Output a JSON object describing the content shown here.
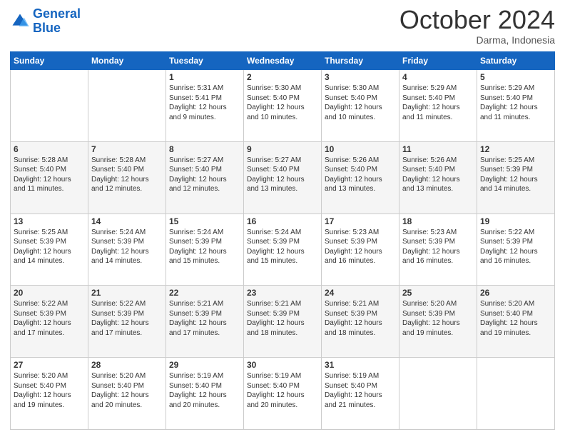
{
  "header": {
    "logo_line1": "General",
    "logo_line2": "Blue",
    "month": "October 2024",
    "location": "Darma, Indonesia"
  },
  "days_of_week": [
    "Sunday",
    "Monday",
    "Tuesday",
    "Wednesday",
    "Thursday",
    "Friday",
    "Saturday"
  ],
  "weeks": [
    [
      {
        "day": "",
        "info": ""
      },
      {
        "day": "",
        "info": ""
      },
      {
        "day": "1",
        "info": "Sunrise: 5:31 AM\nSunset: 5:41 PM\nDaylight: 12 hours and 9 minutes."
      },
      {
        "day": "2",
        "info": "Sunrise: 5:30 AM\nSunset: 5:40 PM\nDaylight: 12 hours and 10 minutes."
      },
      {
        "day": "3",
        "info": "Sunrise: 5:30 AM\nSunset: 5:40 PM\nDaylight: 12 hours and 10 minutes."
      },
      {
        "day": "4",
        "info": "Sunrise: 5:29 AM\nSunset: 5:40 PM\nDaylight: 12 hours and 11 minutes."
      },
      {
        "day": "5",
        "info": "Sunrise: 5:29 AM\nSunset: 5:40 PM\nDaylight: 12 hours and 11 minutes."
      }
    ],
    [
      {
        "day": "6",
        "info": "Sunrise: 5:28 AM\nSunset: 5:40 PM\nDaylight: 12 hours and 11 minutes."
      },
      {
        "day": "7",
        "info": "Sunrise: 5:28 AM\nSunset: 5:40 PM\nDaylight: 12 hours and 12 minutes."
      },
      {
        "day": "8",
        "info": "Sunrise: 5:27 AM\nSunset: 5:40 PM\nDaylight: 12 hours and 12 minutes."
      },
      {
        "day": "9",
        "info": "Sunrise: 5:27 AM\nSunset: 5:40 PM\nDaylight: 12 hours and 13 minutes."
      },
      {
        "day": "10",
        "info": "Sunrise: 5:26 AM\nSunset: 5:40 PM\nDaylight: 12 hours and 13 minutes."
      },
      {
        "day": "11",
        "info": "Sunrise: 5:26 AM\nSunset: 5:40 PM\nDaylight: 12 hours and 13 minutes."
      },
      {
        "day": "12",
        "info": "Sunrise: 5:25 AM\nSunset: 5:39 PM\nDaylight: 12 hours and 14 minutes."
      }
    ],
    [
      {
        "day": "13",
        "info": "Sunrise: 5:25 AM\nSunset: 5:39 PM\nDaylight: 12 hours and 14 minutes."
      },
      {
        "day": "14",
        "info": "Sunrise: 5:24 AM\nSunset: 5:39 PM\nDaylight: 12 hours and 14 minutes."
      },
      {
        "day": "15",
        "info": "Sunrise: 5:24 AM\nSunset: 5:39 PM\nDaylight: 12 hours and 15 minutes."
      },
      {
        "day": "16",
        "info": "Sunrise: 5:24 AM\nSunset: 5:39 PM\nDaylight: 12 hours and 15 minutes."
      },
      {
        "day": "17",
        "info": "Sunrise: 5:23 AM\nSunset: 5:39 PM\nDaylight: 12 hours and 16 minutes."
      },
      {
        "day": "18",
        "info": "Sunrise: 5:23 AM\nSunset: 5:39 PM\nDaylight: 12 hours and 16 minutes."
      },
      {
        "day": "19",
        "info": "Sunrise: 5:22 AM\nSunset: 5:39 PM\nDaylight: 12 hours and 16 minutes."
      }
    ],
    [
      {
        "day": "20",
        "info": "Sunrise: 5:22 AM\nSunset: 5:39 PM\nDaylight: 12 hours and 17 minutes."
      },
      {
        "day": "21",
        "info": "Sunrise: 5:22 AM\nSunset: 5:39 PM\nDaylight: 12 hours and 17 minutes."
      },
      {
        "day": "22",
        "info": "Sunrise: 5:21 AM\nSunset: 5:39 PM\nDaylight: 12 hours and 17 minutes."
      },
      {
        "day": "23",
        "info": "Sunrise: 5:21 AM\nSunset: 5:39 PM\nDaylight: 12 hours and 18 minutes."
      },
      {
        "day": "24",
        "info": "Sunrise: 5:21 AM\nSunset: 5:39 PM\nDaylight: 12 hours and 18 minutes."
      },
      {
        "day": "25",
        "info": "Sunrise: 5:20 AM\nSunset: 5:39 PM\nDaylight: 12 hours and 19 minutes."
      },
      {
        "day": "26",
        "info": "Sunrise: 5:20 AM\nSunset: 5:40 PM\nDaylight: 12 hours and 19 minutes."
      }
    ],
    [
      {
        "day": "27",
        "info": "Sunrise: 5:20 AM\nSunset: 5:40 PM\nDaylight: 12 hours and 19 minutes."
      },
      {
        "day": "28",
        "info": "Sunrise: 5:20 AM\nSunset: 5:40 PM\nDaylight: 12 hours and 20 minutes."
      },
      {
        "day": "29",
        "info": "Sunrise: 5:19 AM\nSunset: 5:40 PM\nDaylight: 12 hours and 20 minutes."
      },
      {
        "day": "30",
        "info": "Sunrise: 5:19 AM\nSunset: 5:40 PM\nDaylight: 12 hours and 20 minutes."
      },
      {
        "day": "31",
        "info": "Sunrise: 5:19 AM\nSunset: 5:40 PM\nDaylight: 12 hours and 21 minutes."
      },
      {
        "day": "",
        "info": ""
      },
      {
        "day": "",
        "info": ""
      }
    ]
  ]
}
